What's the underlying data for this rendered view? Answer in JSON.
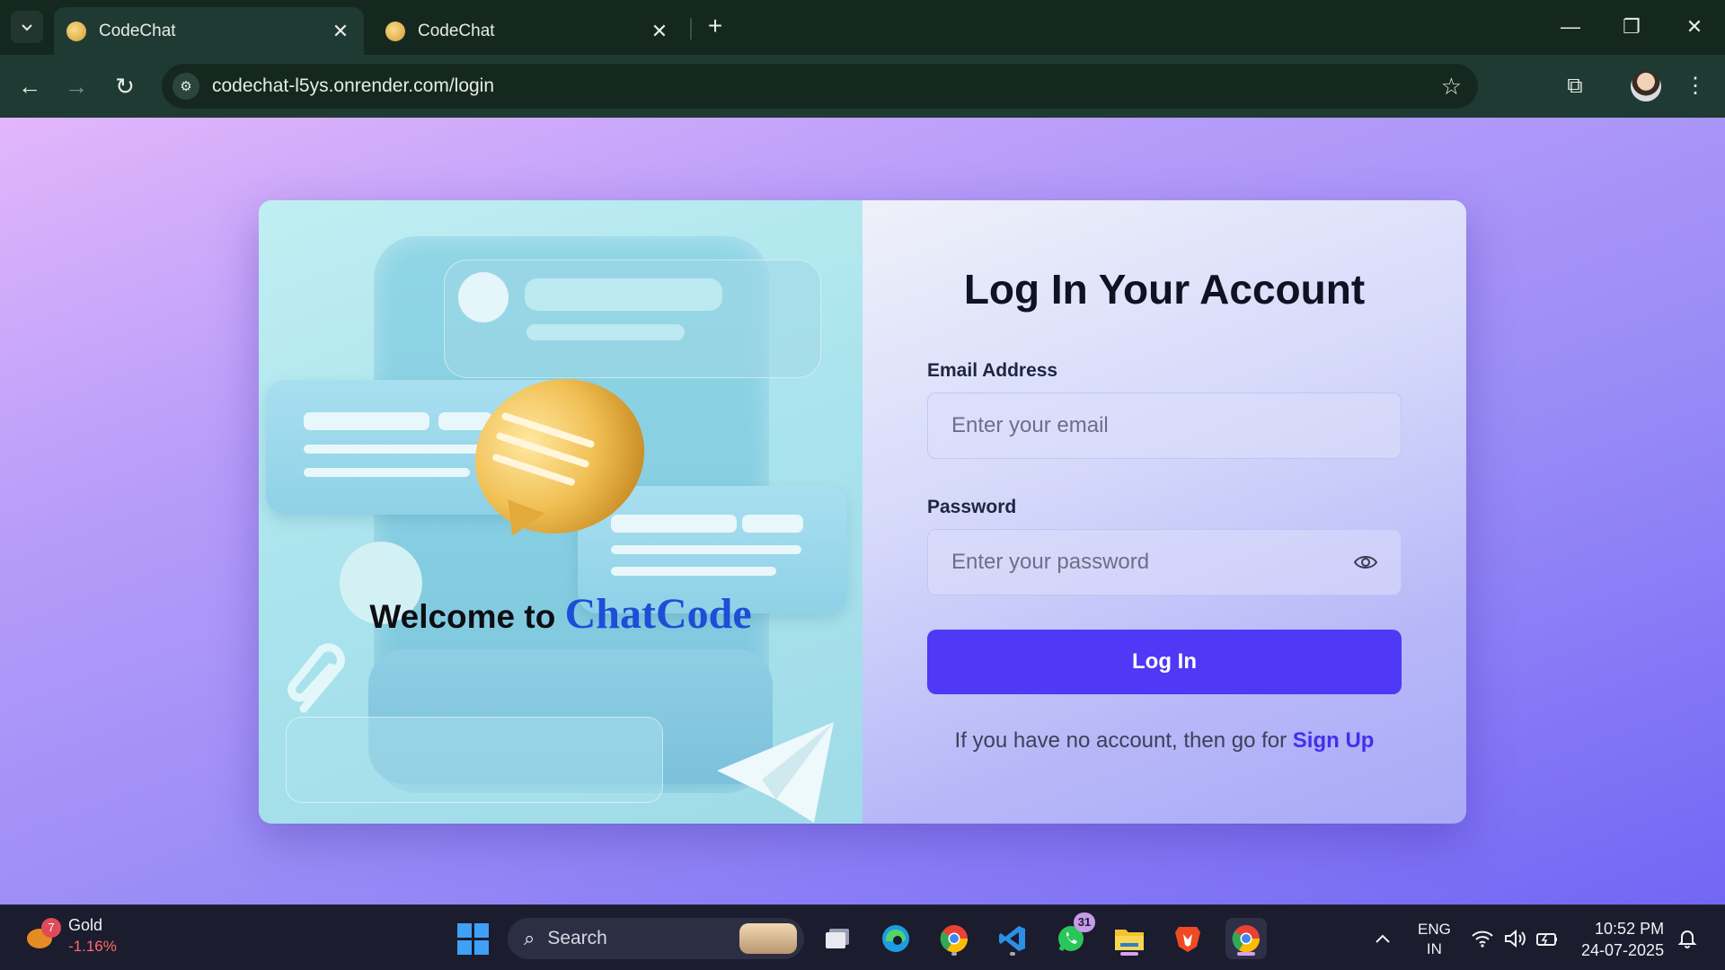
{
  "browser": {
    "tabs": [
      {
        "title": "CodeChat",
        "active": true
      },
      {
        "title": "CodeChat",
        "active": false
      }
    ],
    "url": "codechat-l5ys.onrender.com/login"
  },
  "illustration": {
    "welcome_prefix": "Welcome to",
    "brand": "ChatCode"
  },
  "login": {
    "heading": "Log In Your Account",
    "email_label": "Email Address",
    "email_placeholder": "Enter your email",
    "password_label": "Password",
    "password_placeholder": "Enter your password",
    "submit_label": "Log In",
    "signup_prompt": "If you have no account, then go for",
    "signup_link": "Sign Up"
  },
  "taskbar": {
    "widget_name": "Gold",
    "widget_change": "-1.16%",
    "widget_badge": "7",
    "search_label": "Search",
    "whatsapp_badge": "31",
    "lang_top": "ENG",
    "lang_bottom": "IN",
    "time": "10:52 PM",
    "date": "24-07-2025"
  },
  "colors": {
    "accent": "#4f38f6",
    "brand_text": "#1c4ed8",
    "link": "#3f30ef"
  }
}
